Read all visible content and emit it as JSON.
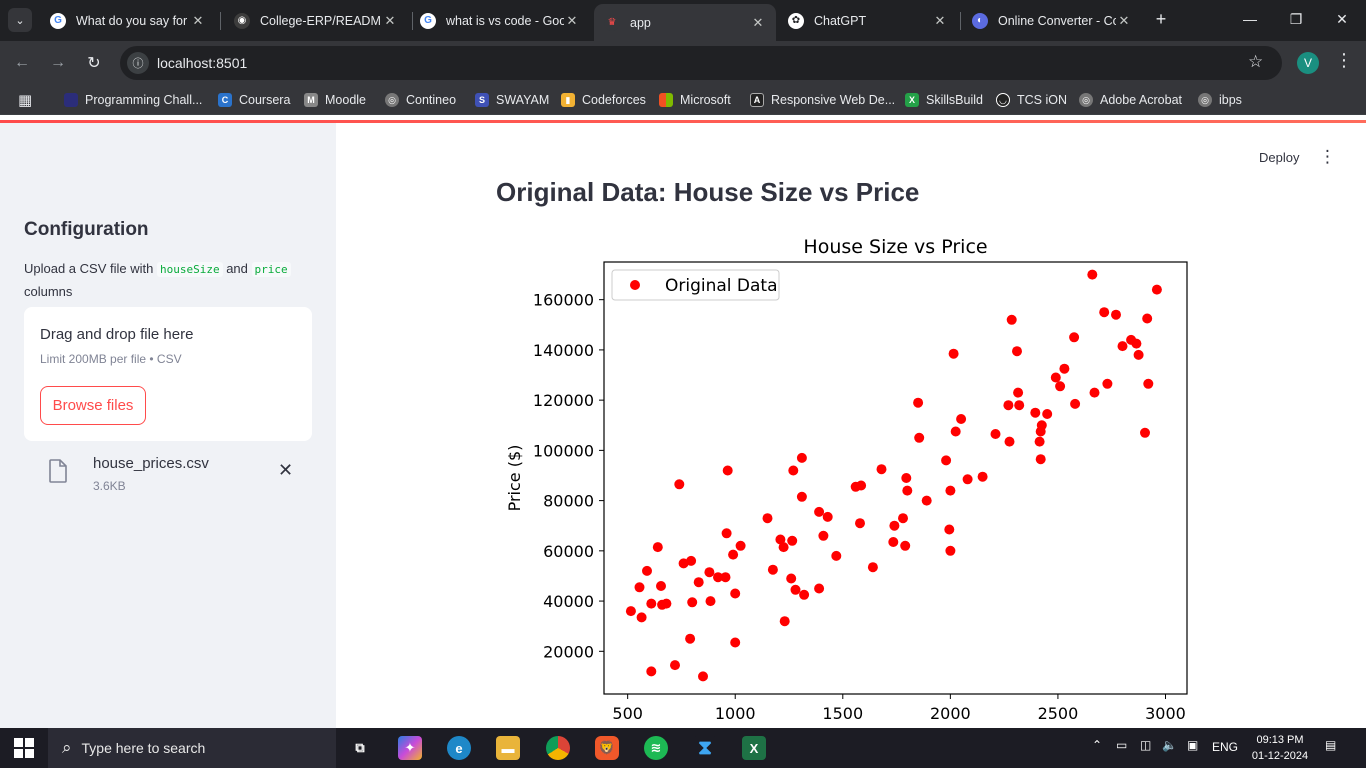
{
  "browser": {
    "tabs": [
      {
        "title": "What do you say for t",
        "favicon": "google-icon"
      },
      {
        "title": "College-ERP/READM",
        "favicon": "github-icon"
      },
      {
        "title": "what is vs code - Goo",
        "favicon": "google-icon"
      },
      {
        "title": "app",
        "favicon": "streamlit-icon",
        "active": true
      },
      {
        "title": "ChatGPT",
        "favicon": "chatgpt-icon"
      },
      {
        "title": "Online Converter - Co",
        "favicon": "converter-icon"
      }
    ],
    "url": "localhost:8501",
    "profile_initial": "V",
    "bookmarks": [
      {
        "label": "Programming Chall...",
        "color": "#2b2d7a"
      },
      {
        "label": "Coursera",
        "color": "#2a73cc"
      },
      {
        "label": "Moodle",
        "color": "#888888"
      },
      {
        "label": "Contineo",
        "color": "#777777"
      },
      {
        "label": "SWAYAM",
        "color": "#3f51b5"
      },
      {
        "label": "Codeforces",
        "color": "#f2b233"
      },
      {
        "label": "Microsoft",
        "color": "#f25022"
      },
      {
        "label": "Responsive Web De...",
        "color": "#222222"
      },
      {
        "label": "SkillsBuild",
        "color": "#24a148"
      },
      {
        "label": "TCS iON",
        "color": "#222222"
      },
      {
        "label": "Adobe Acrobat",
        "color": "#777777"
      },
      {
        "label": "ibps",
        "color": "#777777"
      }
    ]
  },
  "sidebar": {
    "title": "Configuration",
    "desc_prefix": "Upload a CSV file with",
    "code1": "houseSize",
    "desc_and": "and",
    "code2": "price",
    "desc_suffix": "columns",
    "dropzone_title": "Drag and drop file here",
    "dropzone_limit": "Limit 200MB per file • CSV",
    "browse_label": "Browse files",
    "file_name": "house_prices.csv",
    "file_size": "3.6KB"
  },
  "main": {
    "deploy_label": "Deploy",
    "page_title": "Original Data: House Size vs Price"
  },
  "chart_data": {
    "type": "scatter",
    "title": "House Size vs Price",
    "xlabel": "",
    "ylabel": "Price ($)",
    "xlim": [
      390,
      3100
    ],
    "ylim": [
      3000,
      175000
    ],
    "xticks": [
      500,
      1000,
      1500,
      2000,
      2500,
      3000
    ],
    "yticks": [
      20000,
      40000,
      60000,
      80000,
      100000,
      120000,
      140000,
      160000
    ],
    "legend": "top-left",
    "color": "#ff0000",
    "series": [
      {
        "name": "Original Data",
        "points": [
          [
            515,
            36000
          ],
          [
            555,
            45500
          ],
          [
            565,
            33500
          ],
          [
            590,
            52000
          ],
          [
            610,
            12000
          ],
          [
            610,
            39000
          ],
          [
            640,
            61500
          ],
          [
            655,
            46000
          ],
          [
            660,
            38500
          ],
          [
            680,
            39000
          ],
          [
            720,
            14500
          ],
          [
            740,
            86500
          ],
          [
            760,
            55000
          ],
          [
            790,
            25000
          ],
          [
            795,
            56000
          ],
          [
            800,
            39500
          ],
          [
            830,
            47500
          ],
          [
            850,
            10000
          ],
          [
            880,
            51500
          ],
          [
            885,
            40000
          ],
          [
            920,
            49500
          ],
          [
            955,
            49500
          ],
          [
            960,
            67000
          ],
          [
            965,
            92000
          ],
          [
            990,
            58500
          ],
          [
            1000,
            43000
          ],
          [
            1000,
            23500
          ],
          [
            1025,
            62000
          ],
          [
            1150,
            73000
          ],
          [
            1175,
            52500
          ],
          [
            1210,
            64500
          ],
          [
            1225,
            61500
          ],
          [
            1230,
            32000
          ],
          [
            1260,
            49000
          ],
          [
            1265,
            64000
          ],
          [
            1270,
            92000
          ],
          [
            1280,
            44500
          ],
          [
            1310,
            81500
          ],
          [
            1310,
            97000
          ],
          [
            1320,
            42500
          ],
          [
            1390,
            75500
          ],
          [
            1390,
            45000
          ],
          [
            1410,
            66000
          ],
          [
            1430,
            73500
          ],
          [
            1470,
            58000
          ],
          [
            1560,
            85500
          ],
          [
            1580,
            71000
          ],
          [
            1585,
            86000
          ],
          [
            1640,
            53500
          ],
          [
            1680,
            92500
          ],
          [
            1735,
            63500
          ],
          [
            1740,
            70000
          ],
          [
            1780,
            73000
          ],
          [
            1790,
            62000
          ],
          [
            1795,
            89000
          ],
          [
            1800,
            84000
          ],
          [
            1850,
            119000
          ],
          [
            1855,
            105000
          ],
          [
            1890,
            80000
          ],
          [
            1980,
            96000
          ],
          [
            1995,
            68500
          ],
          [
            2000,
            60000
          ],
          [
            2000,
            84000
          ],
          [
            2015,
            138500
          ],
          [
            2025,
            107500
          ],
          [
            2050,
            112500
          ],
          [
            2080,
            88500
          ],
          [
            2150,
            89500
          ],
          [
            2210,
            106500
          ],
          [
            2270,
            118000
          ],
          [
            2275,
            103500
          ],
          [
            2285,
            152000
          ],
          [
            2310,
            139500
          ],
          [
            2315,
            123000
          ],
          [
            2320,
            118000
          ],
          [
            2395,
            115000
          ],
          [
            2415,
            103500
          ],
          [
            2420,
            96500
          ],
          [
            2420,
            107500
          ],
          [
            2425,
            110000
          ],
          [
            2450,
            114500
          ],
          [
            2490,
            129000
          ],
          [
            2510,
            125500
          ],
          [
            2530,
            132500
          ],
          [
            2575,
            145000
          ],
          [
            2580,
            118500
          ],
          [
            2660,
            170000
          ],
          [
            2670,
            123000
          ],
          [
            2715,
            155000
          ],
          [
            2730,
            126500
          ],
          [
            2770,
            154000
          ],
          [
            2800,
            141500
          ],
          [
            2840,
            144000
          ],
          [
            2865,
            142500
          ],
          [
            2875,
            138000
          ],
          [
            2905,
            107000
          ],
          [
            2915,
            152500
          ],
          [
            2920,
            126500
          ],
          [
            2960,
            164000
          ]
        ]
      }
    ]
  },
  "taskbar": {
    "search_placeholder": "Type here to search",
    "lang": "ENG",
    "time": "09:13 PM",
    "date": "01-12-2024"
  }
}
